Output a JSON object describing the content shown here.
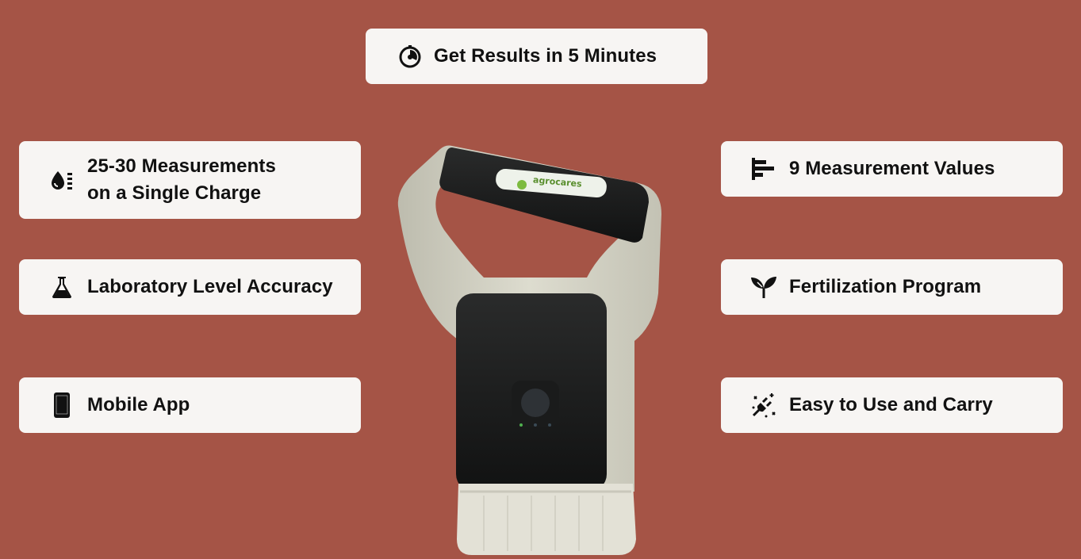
{
  "colors": {
    "background": "#A55446",
    "card": "#F7F5F3",
    "text": "#111111"
  },
  "features": {
    "results": {
      "label": "Get Results in 5 Minutes",
      "icon": "timer-icon"
    },
    "measurements": {
      "line1": "25-30 Measurements",
      "line2": "on a Single Charge",
      "icon": "battery-drop-icon"
    },
    "accuracy": {
      "label": "Laboratory Level Accuracy",
      "icon": "flask-icon"
    },
    "mobile": {
      "label": "Mobile App",
      "icon": "phone-icon"
    },
    "values": {
      "label": "9 Measurement Values",
      "icon": "bars-icon"
    },
    "fertilization": {
      "label": "Fertilization Program",
      "icon": "sprout-icon"
    },
    "easy": {
      "label": "Easy to Use and Carry",
      "icon": "sparkle-plug-icon"
    }
  },
  "device": {
    "brand": "agrocares"
  }
}
